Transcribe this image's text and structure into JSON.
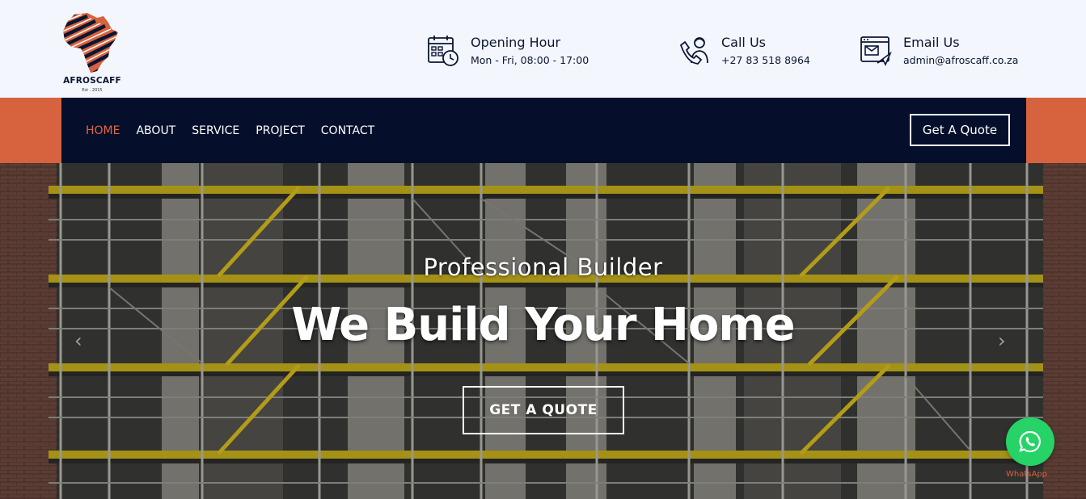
{
  "brand": {
    "name": "AFROSCAFF",
    "est": "Est . 2015",
    "colors": {
      "navy": "#050f2b",
      "accent": "#d6623e",
      "whatsapp": "#25d366"
    }
  },
  "header": {
    "opening": {
      "title": "Opening Hour",
      "value": "Mon - Fri, 08:00 - 17:00",
      "icon": "calendar-clock-icon"
    },
    "call": {
      "title": "Call Us",
      "value": "+27 83 518 8964",
      "icon": "phone-support-icon"
    },
    "email": {
      "title": "Email Us",
      "value": "admin@afroscaff.co.za",
      "icon": "email-browser-icon"
    }
  },
  "nav": {
    "items": [
      {
        "label": "HOME",
        "active": true
      },
      {
        "label": "ABOUT"
      },
      {
        "label": "SERVICE"
      },
      {
        "label": "PROJECT"
      },
      {
        "label": "CONTACT"
      }
    ],
    "cta": "Get A Quote"
  },
  "hero": {
    "subtitle": "Professional Builder",
    "title": "We Build Your Home",
    "button": "GET A QUOTE",
    "prev_icon": "chevron-left-icon",
    "next_icon": "chevron-right-icon"
  },
  "whatsapp": {
    "label": "WhatsApp",
    "icon": "whatsapp-icon"
  }
}
